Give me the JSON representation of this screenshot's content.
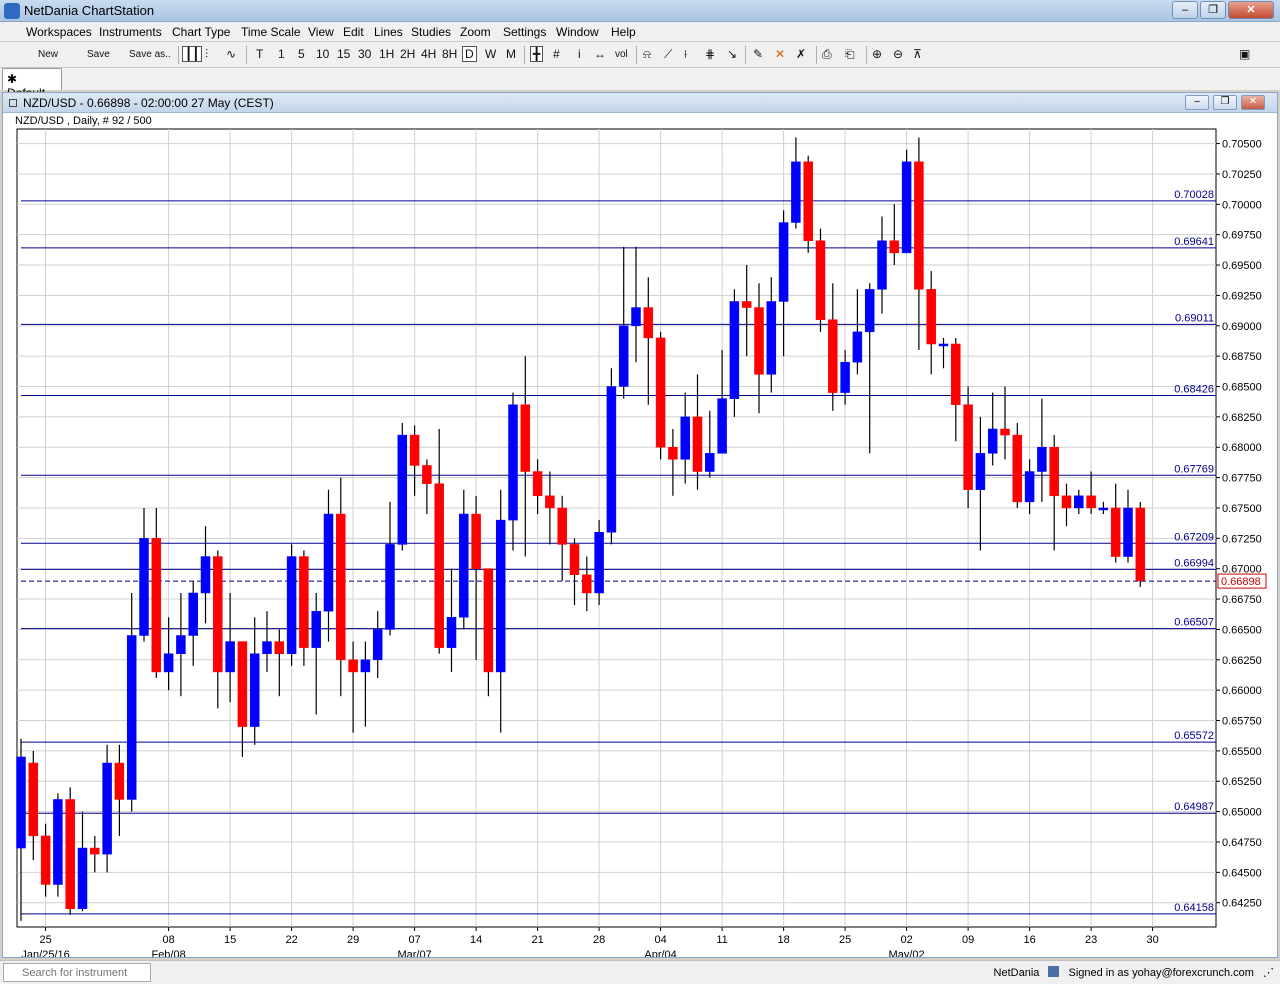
{
  "window": {
    "title": "NetDania ChartStation"
  },
  "menu": [
    "Workspaces",
    "Instruments",
    "Chart Type",
    "Time Scale",
    "View",
    "Edit",
    "Lines",
    "Studies",
    "Zoom",
    "Settings",
    "Window",
    "Help"
  ],
  "toolbar": {
    "new_label": "New",
    "save_label": "Save",
    "saveas_label": "Save as..",
    "timescales": [
      "T",
      "1",
      "5",
      "10",
      "15",
      "30",
      "1H",
      "2H",
      "4H",
      "8H",
      "D",
      "W",
      "M"
    ],
    "selected_timescale": "D",
    "vol_label": "vol",
    "info_label": "i"
  },
  "tabs": [
    {
      "label": "Default"
    }
  ],
  "chart_window": {
    "title": "NZD/USD - 0.66898 - 02:00:00  27 May (CEST)"
  },
  "statusbar": {
    "search_placeholder": "Search for instrument",
    "brand": "NetDania",
    "signed_in": "Signed in as yohay@forexcrunch.com"
  },
  "colors": {
    "up": "#0000ff",
    "down": "#ff0000",
    "hline": "#00008b",
    "current_price": "#cc0000"
  },
  "chart_data": {
    "type": "candlestick",
    "title": "NZD/USD , Daily, # 92 / 500",
    "ylim": [
      0.6405,
      0.7062
    ],
    "y_tick_values": [
      0.6425,
      0.645,
      0.6475,
      0.65,
      0.6525,
      0.655,
      0.6575,
      0.66,
      0.6625,
      0.665,
      0.6675,
      0.67,
      0.6725,
      0.675,
      0.6775,
      0.68,
      0.6825,
      0.685,
      0.6875,
      0.69,
      0.6925,
      0.695,
      0.6975,
      0.7,
      0.7025,
      0.705
    ],
    "y_tick_labels": [
      "0.64250",
      "0.64500",
      "0.64750",
      "0.65000",
      "0.65250",
      "0.65500",
      "0.65750",
      "0.66000",
      "0.66250",
      "0.66500",
      "0.66750",
      "0.67000",
      "0.67250",
      "0.67500",
      "0.67750",
      "0.68000",
      "0.68250",
      "0.68500",
      "0.68750",
      "0.69000",
      "0.69250",
      "0.69500",
      "0.69750",
      "0.70000",
      "0.70250",
      "0.70500"
    ],
    "x_ticks": [
      {
        "index": 2,
        "label": "25",
        "sub": "Jan/25/16"
      },
      {
        "index": 12,
        "label": "08",
        "sub": "Feb/08"
      },
      {
        "index": 17,
        "label": "15",
        "sub": ""
      },
      {
        "index": 22,
        "label": "22",
        "sub": ""
      },
      {
        "index": 27,
        "label": "29",
        "sub": ""
      },
      {
        "index": 32,
        "label": "07",
        "sub": "Mar/07"
      },
      {
        "index": 37,
        "label": "14",
        "sub": ""
      },
      {
        "index": 42,
        "label": "21",
        "sub": ""
      },
      {
        "index": 47,
        "label": "28",
        "sub": ""
      },
      {
        "index": 52,
        "label": "04",
        "sub": "Apr/04"
      },
      {
        "index": 57,
        "label": "11",
        "sub": ""
      },
      {
        "index": 62,
        "label": "18",
        "sub": ""
      },
      {
        "index": 67,
        "label": "25",
        "sub": ""
      },
      {
        "index": 72,
        "label": "02",
        "sub": "May/02"
      },
      {
        "index": 77,
        "label": "09",
        "sub": ""
      },
      {
        "index": 82,
        "label": "16",
        "sub": ""
      },
      {
        "index": 87,
        "label": "23",
        "sub": ""
      },
      {
        "index": 92,
        "label": "30",
        "sub": ""
      }
    ],
    "hlines": [
      {
        "value": 0.70028,
        "label": "0.70028"
      },
      {
        "value": 0.69641,
        "label": "0.69641"
      },
      {
        "value": 0.69011,
        "label": "0.69011"
      },
      {
        "value": 0.68426,
        "label": "0.68426"
      },
      {
        "value": 0.67769,
        "label": "0.67769"
      },
      {
        "value": 0.67209,
        "label": "0.67209"
      },
      {
        "value": 0.66994,
        "label": "0.66994"
      },
      {
        "value": 0.66507,
        "label": "0.66507"
      },
      {
        "value": 0.65572,
        "label": "0.65572"
      },
      {
        "value": 0.64987,
        "label": "0.64987"
      },
      {
        "value": 0.64158,
        "label": "0.64158"
      }
    ],
    "current_price": {
      "value": 0.66898,
      "label": "0.66898"
    },
    "candles": [
      [
        0.647,
        0.6545,
        0.641,
        0.656
      ],
      [
        0.654,
        0.648,
        0.646,
        0.655
      ],
      [
        0.648,
        0.644,
        0.643,
        0.649
      ],
      [
        0.644,
        0.651,
        0.643,
        0.6515
      ],
      [
        0.651,
        0.642,
        0.6415,
        0.652
      ],
      [
        0.642,
        0.647,
        0.6418,
        0.65
      ],
      [
        0.647,
        0.6465,
        0.645,
        0.648
      ],
      [
        0.6465,
        0.654,
        0.645,
        0.6555
      ],
      [
        0.654,
        0.651,
        0.648,
        0.6555
      ],
      [
        0.651,
        0.6645,
        0.65,
        0.668
      ],
      [
        0.6645,
        0.6725,
        0.664,
        0.675
      ],
      [
        0.6725,
        0.6615,
        0.661,
        0.675
      ],
      [
        0.6615,
        0.663,
        0.66,
        0.666
      ],
      [
        0.663,
        0.6645,
        0.6595,
        0.668
      ],
      [
        0.6645,
        0.668,
        0.662,
        0.669
      ],
      [
        0.668,
        0.671,
        0.6655,
        0.6735
      ],
      [
        0.671,
        0.6615,
        0.6585,
        0.6715
      ],
      [
        0.6615,
        0.664,
        0.659,
        0.668
      ],
      [
        0.664,
        0.657,
        0.6545,
        0.664
      ],
      [
        0.657,
        0.663,
        0.6555,
        0.666
      ],
      [
        0.663,
        0.664,
        0.6615,
        0.6665
      ],
      [
        0.664,
        0.663,
        0.6595,
        0.665
      ],
      [
        0.663,
        0.671,
        0.662,
        0.672
      ],
      [
        0.671,
        0.6635,
        0.662,
        0.6715
      ],
      [
        0.6635,
        0.6665,
        0.658,
        0.668
      ],
      [
        0.6665,
        0.6745,
        0.664,
        0.6765
      ],
      [
        0.6745,
        0.6625,
        0.6595,
        0.6775
      ],
      [
        0.6625,
        0.6615,
        0.6565,
        0.664
      ],
      [
        0.6615,
        0.6625,
        0.657,
        0.664
      ],
      [
        0.6625,
        0.665,
        0.661,
        0.6665
      ],
      [
        0.665,
        0.672,
        0.6645,
        0.6755
      ],
      [
        0.672,
        0.681,
        0.6715,
        0.682
      ],
      [
        0.681,
        0.6785,
        0.676,
        0.6818
      ],
      [
        0.6785,
        0.677,
        0.6745,
        0.679
      ],
      [
        0.677,
        0.6635,
        0.663,
        0.6815
      ],
      [
        0.6635,
        0.666,
        0.6615,
        0.67
      ],
      [
        0.666,
        0.6745,
        0.665,
        0.6765
      ],
      [
        0.6745,
        0.67,
        0.6625,
        0.676
      ],
      [
        0.67,
        0.6615,
        0.6595,
        0.668
      ],
      [
        0.6615,
        0.674,
        0.6565,
        0.6765
      ],
      [
        0.674,
        0.6835,
        0.6715,
        0.6845
      ],
      [
        0.6835,
        0.678,
        0.671,
        0.6875
      ],
      [
        0.678,
        0.676,
        0.6745,
        0.679
      ],
      [
        0.676,
        0.675,
        0.672,
        0.678
      ],
      [
        0.675,
        0.672,
        0.669,
        0.676
      ],
      [
        0.672,
        0.6695,
        0.667,
        0.6725
      ],
      [
        0.6695,
        0.668,
        0.6665,
        0.671
      ],
      [
        0.668,
        0.673,
        0.667,
        0.674
      ],
      [
        0.673,
        0.685,
        0.672,
        0.6865
      ],
      [
        0.685,
        0.69,
        0.684,
        0.6965
      ],
      [
        0.69,
        0.6915,
        0.687,
        0.6965
      ],
      [
        0.6915,
        0.689,
        0.6835,
        0.694
      ],
      [
        0.689,
        0.68,
        0.679,
        0.6895
      ],
      [
        0.68,
        0.679,
        0.676,
        0.6815
      ],
      [
        0.679,
        0.6825,
        0.677,
        0.6845
      ],
      [
        0.6825,
        0.678,
        0.6765,
        0.686
      ],
      [
        0.678,
        0.6795,
        0.6775,
        0.683
      ],
      [
        0.6795,
        0.684,
        0.6815,
        0.688
      ],
      [
        0.684,
        0.692,
        0.6825,
        0.693
      ],
      [
        0.692,
        0.6915,
        0.6875,
        0.695
      ],
      [
        0.6915,
        0.686,
        0.6828,
        0.6935
      ],
      [
        0.686,
        0.692,
        0.6845,
        0.694
      ],
      [
        0.692,
        0.6985,
        0.6875,
        0.6995
      ],
      [
        0.6985,
        0.7035,
        0.698,
        0.7055
      ],
      [
        0.7035,
        0.697,
        0.696,
        0.704
      ],
      [
        0.697,
        0.6905,
        0.6895,
        0.698
      ],
      [
        0.6905,
        0.6845,
        0.683,
        0.6935
      ],
      [
        0.6845,
        0.687,
        0.6835,
        0.688
      ],
      [
        0.687,
        0.6895,
        0.686,
        0.693
      ],
      [
        0.6895,
        0.693,
        0.6795,
        0.6935
      ],
      [
        0.693,
        0.697,
        0.691,
        0.699
      ],
      [
        0.697,
        0.696,
        0.695,
        0.7
      ],
      [
        0.696,
        0.7035,
        0.6985,
        0.7045
      ],
      [
        0.7035,
        0.693,
        0.688,
        0.7055
      ],
      [
        0.693,
        0.6885,
        0.686,
        0.6945
      ],
      [
        0.6885,
        0.6885,
        0.6865,
        0.689
      ],
      [
        0.6885,
        0.6835,
        0.6805,
        0.689
      ],
      [
        0.6835,
        0.6765,
        0.675,
        0.685
      ],
      [
        0.6765,
        0.6795,
        0.6715,
        0.6825
      ],
      [
        0.6795,
        0.6815,
        0.6785,
        0.6845
      ],
      [
        0.6815,
        0.681,
        0.679,
        0.685
      ],
      [
        0.681,
        0.6755,
        0.675,
        0.682
      ],
      [
        0.6755,
        0.678,
        0.6745,
        0.679
      ],
      [
        0.678,
        0.68,
        0.6755,
        0.684
      ],
      [
        0.68,
        0.676,
        0.6715,
        0.681
      ],
      [
        0.676,
        0.675,
        0.6735,
        0.677
      ],
      [
        0.675,
        0.676,
        0.6745,
        0.6765
      ],
      [
        0.676,
        0.675,
        0.6745,
        0.678
      ],
      [
        0.675,
        0.675,
        0.6745,
        0.6755
      ],
      [
        0.675,
        0.671,
        0.6705,
        0.677
      ],
      [
        0.671,
        0.675,
        0.6705,
        0.6765
      ],
      [
        0.675,
        0.669,
        0.6685,
        0.6755
      ]
    ]
  }
}
